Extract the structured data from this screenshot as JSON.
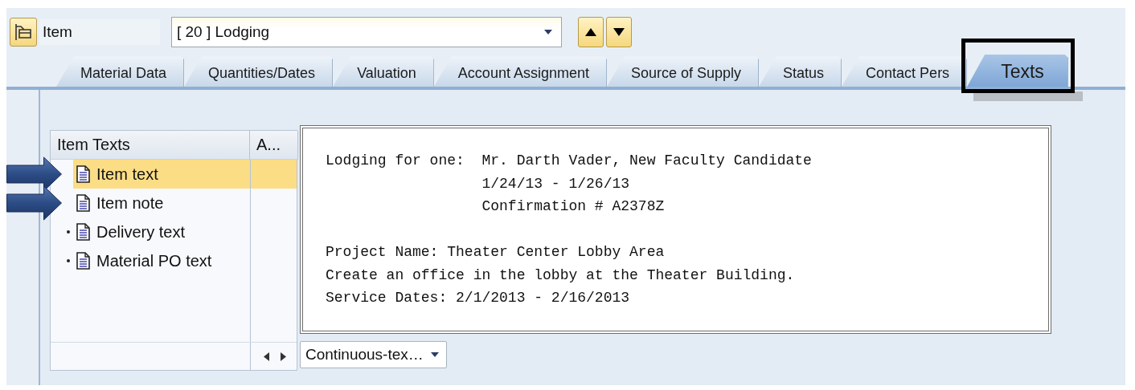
{
  "header": {
    "item_label": "Item",
    "item_value": "[ 20 ] Lodging"
  },
  "tabs": [
    {
      "label": "Material Data",
      "selected": false,
      "highlighted": false
    },
    {
      "label": "Quantities/Dates",
      "selected": false,
      "highlighted": false
    },
    {
      "label": "Valuation",
      "selected": false,
      "highlighted": false
    },
    {
      "label": "Account Assignment",
      "selected": false,
      "highlighted": false
    },
    {
      "label": "Source of Supply",
      "selected": false,
      "highlighted": false
    },
    {
      "label": "Status",
      "selected": false,
      "highlighted": false
    },
    {
      "label": "Contact Pers",
      "selected": false,
      "highlighted": false
    },
    {
      "label": "Texts",
      "selected": true,
      "highlighted": true
    }
  ],
  "text_tree": {
    "columns": [
      "Item Texts",
      "A..."
    ],
    "items": [
      {
        "label": "Item text",
        "selected": true,
        "bullet": false,
        "arrow": true
      },
      {
        "label": "Item note",
        "selected": false,
        "bullet": false,
        "arrow": true
      },
      {
        "label": "Delivery text",
        "selected": false,
        "bullet": true,
        "arrow": false
      },
      {
        "label": "Material PO text",
        "selected": false,
        "bullet": true,
        "arrow": false
      }
    ]
  },
  "editor": {
    "paragraphs": [
      {
        "label": "Lodging for one:",
        "lines": [
          "Mr. Darth Vader, New Faculty Candidate",
          "1/24/13 - 1/26/13",
          "Confirmation # A2378Z"
        ]
      },
      {
        "lines": [
          "Project Name: Theater Center Lobby Area",
          "Create an office in the lobby at the Theater Building.",
          "Service Dates: 2/1/2013 - 2/16/2013"
        ]
      }
    ]
  },
  "format_dropdown": {
    "value": "Continuous-tex…"
  }
}
